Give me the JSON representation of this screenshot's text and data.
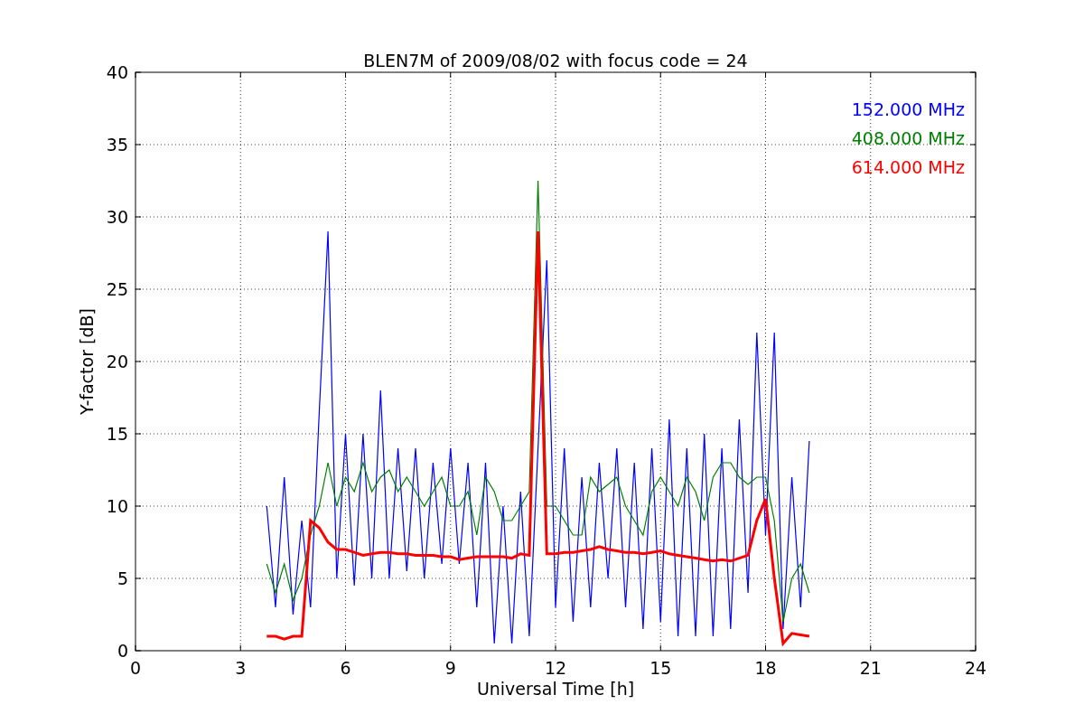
{
  "figure": {
    "chart_data": {
      "type": "line",
      "grid": true,
      "title": "BLEN7M of 2009/08/02 with focus code = 24",
      "xlabel": "Universal Time [h]",
      "ylabel": "Y-factor [dB]",
      "xlim": [
        0,
        24
      ],
      "ylim": [
        0,
        40
      ],
      "xticks": [
        0,
        3,
        6,
        9,
        12,
        15,
        18,
        21,
        24
      ],
      "yticks": [
        0,
        5,
        10,
        15,
        20,
        25,
        30,
        35,
        40
      ],
      "x": [
        3.75,
        4.0,
        4.25,
        4.5,
        4.75,
        5.0,
        5.25,
        5.5,
        5.75,
        6.0,
        6.25,
        6.5,
        6.75,
        7.0,
        7.25,
        7.5,
        7.75,
        8.0,
        8.25,
        8.5,
        8.75,
        9.0,
        9.25,
        9.5,
        9.75,
        10.0,
        10.25,
        10.5,
        10.75,
        11.0,
        11.25,
        11.5,
        11.75,
        12.0,
        12.25,
        12.5,
        12.75,
        13.0,
        13.25,
        13.5,
        13.75,
        14.0,
        14.25,
        14.5,
        14.75,
        15.0,
        15.25,
        15.5,
        15.75,
        16.0,
        16.25,
        16.5,
        16.75,
        17.0,
        17.25,
        17.5,
        17.75,
        18.0,
        18.25,
        18.5,
        18.75,
        19.0,
        19.25
      ],
      "series": [
        {
          "name": "152.000 MHz",
          "color": "#0000ff",
          "values": [
            10,
            3,
            12,
            2.5,
            9,
            3,
            16.5,
            29,
            5,
            15,
            4.5,
            15,
            5,
            18,
            5,
            14,
            5.5,
            14,
            5,
            13,
            6,
            14,
            6,
            13,
            3,
            13,
            0.5,
            10,
            0.5,
            11,
            1,
            14,
            27,
            3,
            14,
            2,
            12,
            3,
            13,
            5,
            14,
            3,
            13,
            1.5,
            14,
            2,
            16,
            1,
            14,
            1,
            15,
            1,
            14,
            1.5,
            16,
            4,
            22,
            8,
            22,
            1.5,
            12,
            3,
            14.5
          ]
        },
        {
          "name": "408.000 MHz",
          "color": "#008000",
          "values": [
            6,
            4,
            6,
            3.5,
            5,
            8,
            10,
            13,
            10,
            12,
            11,
            13,
            11,
            12,
            12.5,
            11,
            12,
            11,
            10,
            11,
            12,
            10,
            10,
            11,
            8,
            12,
            11,
            9,
            9,
            10,
            11,
            32.5,
            10,
            10,
            9,
            8,
            8,
            12,
            11,
            11.5,
            12,
            10,
            9,
            8,
            11,
            12,
            11,
            10,
            12,
            11,
            9,
            12,
            13,
            13,
            12,
            11.5,
            12,
            12,
            9,
            2,
            5,
            6,
            4
          ]
        },
        {
          "name": "614.000 MHz",
          "color": "#ff0000",
          "values": [
            1,
            1,
            0.8,
            1,
            1,
            9,
            8.5,
            7.5,
            7,
            7,
            6.8,
            6.6,
            6.7,
            6.8,
            6.8,
            6.7,
            6.7,
            6.6,
            6.6,
            6.6,
            6.5,
            6.5,
            6.3,
            6.4,
            6.5,
            6.5,
            6.5,
            6.5,
            6.4,
            6.7,
            6.6,
            29,
            6.7,
            6.7,
            6.8,
            6.8,
            6.9,
            7,
            7.2,
            7,
            6.9,
            6.8,
            6.8,
            6.7,
            6.8,
            6.9,
            6.7,
            6.6,
            6.5,
            6.4,
            6.3,
            6.2,
            6.3,
            6.2,
            6.4,
            6.6,
            9,
            10.5,
            5,
            0.5,
            1.2,
            1.1,
            1
          ]
        }
      ]
    }
  }
}
